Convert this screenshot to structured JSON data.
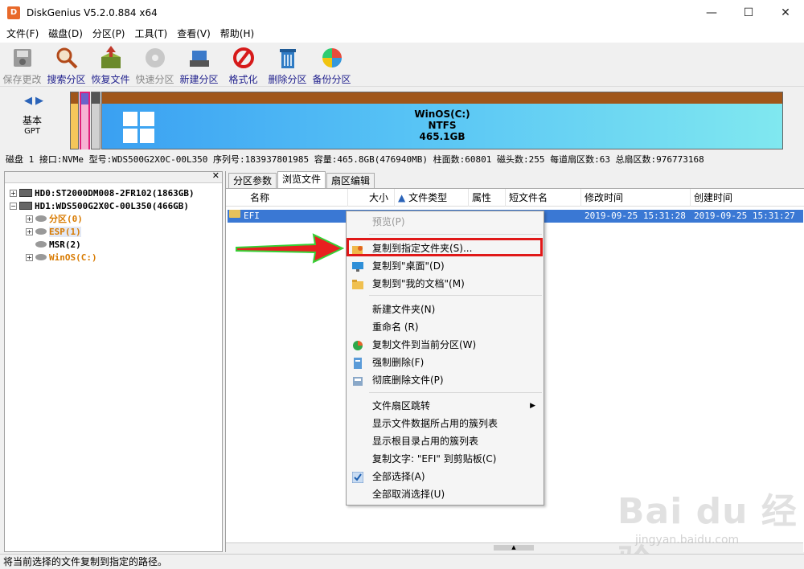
{
  "window": {
    "title": "DiskGenius V5.2.0.884 x64",
    "app_icon": "D"
  },
  "menus": [
    "文件(F)",
    "磁盘(D)",
    "分区(P)",
    "工具(T)",
    "查看(V)",
    "帮助(H)"
  ],
  "toolbar": [
    {
      "label": "保存更改",
      "icon": "save-disk-icon",
      "disabled": true
    },
    {
      "label": "搜索分区",
      "icon": "magnifier-icon"
    },
    {
      "label": "恢复文件",
      "icon": "recover-box-icon"
    },
    {
      "label": "快速分区",
      "icon": "quick-partition-icon",
      "disabled": true
    },
    {
      "label": "新建分区",
      "icon": "new-partition-icon"
    },
    {
      "label": "格式化",
      "icon": "format-icon"
    },
    {
      "label": "删除分区",
      "icon": "trash-icon"
    },
    {
      "label": "备份分区",
      "icon": "backup-icon"
    }
  ],
  "diskmap": {
    "disk_type": "基本",
    "disk_sub": "GPT",
    "partition_name": "WinOS(C:)",
    "partition_fs": "NTFS",
    "partition_size": "465.1GB"
  },
  "disk_info": "磁盘 1 接口:NVMe  型号:WDS500G2X0C-00L350  序列号:183937801985  容量:465.8GB(476940MB)  柱面数:60801  磁头数:255  每道扇区数:63  总扇区数:976773168",
  "tree": [
    {
      "label": "HD0:ST2000DM008-2FR102(1863GB)",
      "color": "#000000"
    },
    {
      "label": "HD1:WDS500G2X0C-00L350(466GB)",
      "color": "#000000"
    },
    {
      "label": "分区(0)",
      "color": "#d87a00"
    },
    {
      "label": "ESP(1)",
      "color": "#d87a00"
    },
    {
      "label": "MSR(2)",
      "color": "#000000"
    },
    {
      "label": "WinOS(C:)",
      "color": "#d87a00"
    }
  ],
  "tabs": [
    "分区参数",
    "浏览文件",
    "扇区编辑"
  ],
  "columns": [
    "名称",
    "大小",
    "文件类型",
    "属性",
    "短文件名",
    "修改时间",
    "创建时间"
  ],
  "file_row": {
    "name": "EFI",
    "modified": "2019-09-25 15:31:28",
    "created": "2019-09-25 15:31:27"
  },
  "context_menu": [
    {
      "label": "预览(P)",
      "disabled": true
    },
    {
      "label": "复制到指定文件夹(S)...",
      "icon": "copy-folder-icon"
    },
    {
      "label": "复制到\"桌面\"(D)",
      "icon": "desktop-icon"
    },
    {
      "label": "复制到\"我的文档\"(M)",
      "icon": "documents-folder-icon"
    },
    {
      "label": "新建文件夹(N)"
    },
    {
      "label": "重命名 (R)"
    },
    {
      "label": "复制文件到当前分区(W)",
      "icon": "pie-icon"
    },
    {
      "label": "强制删除(F)",
      "icon": "force-delete-icon"
    },
    {
      "label": "彻底删除文件(P)",
      "icon": "shred-icon"
    },
    {
      "label": "文件扇区跳转",
      "submenu": true
    },
    {
      "label": "显示文件数据所占用的簇列表"
    },
    {
      "label": "显示根目录占用的簇列表"
    },
    {
      "label": "复制文字: \"EFI\" 到剪贴板(C)"
    },
    {
      "label": "全部选择(A)",
      "icon": "check-icon"
    },
    {
      "label": "全部取消选择(U)"
    }
  ],
  "status": "将当前选择的文件复制到指定的路径。",
  "watermark": {
    "main": "Bai du 经验",
    "sub": "jingyan.baidu.com"
  }
}
